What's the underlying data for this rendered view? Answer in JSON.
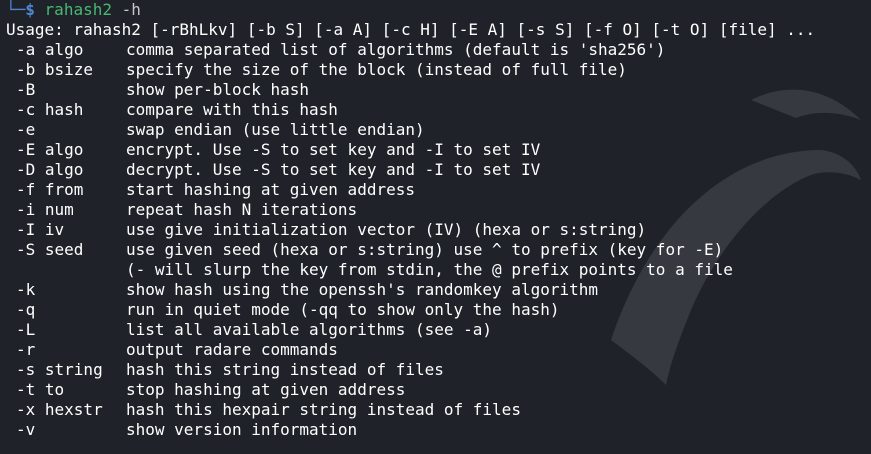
{
  "prompt": {
    "corner": "└─",
    "dollar": "$",
    "command": "rahash2",
    "flag": "-h"
  },
  "usage": "Usage: rahash2 [-rBhLkv] [-b S] [-a A] [-c H] [-E A] [-s S] [-f O] [-t O] [file] ...",
  "options": [
    {
      "flag": "-a algo",
      "desc": "comma separated list of algorithms (default is 'sha256')"
    },
    {
      "flag": "-b bsize",
      "desc": "specify the size of the block (instead of full file)"
    },
    {
      "flag": "-B",
      "desc": "show per-block hash"
    },
    {
      "flag": "-c hash",
      "desc": "compare with this hash"
    },
    {
      "flag": "-e",
      "desc": "swap endian (use little endian)"
    },
    {
      "flag": "-E algo",
      "desc": "encrypt. Use -S to set key and -I to set IV"
    },
    {
      "flag": "-D algo",
      "desc": "decrypt. Use -S to set key and -I to set IV"
    },
    {
      "flag": "-f from",
      "desc": "start hashing at given address"
    },
    {
      "flag": "-i num",
      "desc": "repeat hash N iterations"
    },
    {
      "flag": "-I iv",
      "desc": "use give initialization vector (IV) (hexa or s:string)"
    },
    {
      "flag": "-S seed",
      "desc": "use given seed (hexa or s:string) use ^ to prefix (key for -E)"
    },
    {
      "flag": "",
      "desc": "(- will slurp the key from stdin, the @ prefix points to a file"
    },
    {
      "flag": "-k",
      "desc": "show hash using the openssh's randomkey algorithm"
    },
    {
      "flag": "-q",
      "desc": "run in quiet mode (-qq to show only the hash)"
    },
    {
      "flag": "-L",
      "desc": "list all available algorithms (see -a)"
    },
    {
      "flag": "-r",
      "desc": "output radare commands"
    },
    {
      "flag": "-s string",
      "desc": "hash this string instead of files"
    },
    {
      "flag": "-t to",
      "desc": "stop hashing at given address"
    },
    {
      "flag": "-x hexstr",
      "desc": "hash this hexpair string instead of files"
    },
    {
      "flag": "-v",
      "desc": "show version information"
    }
  ],
  "colors": {
    "background": "#1f2229",
    "prompt_blue": "#4f86d0",
    "command_green": "#48b873",
    "text": "#ffffff"
  }
}
